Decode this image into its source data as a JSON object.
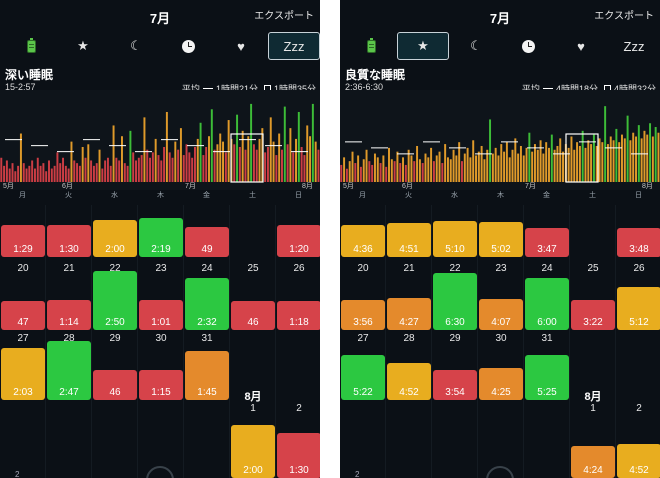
{
  "colors": {
    "background": "#0b1016",
    "red": "#d6434a",
    "yellow": "#e8ad1f",
    "green": "#2cc841",
    "orange": "#e48a2c",
    "chart_red": "#cc3d44",
    "chart_orange": "#df9a2a",
    "chart_green": "#3dbd38"
  },
  "panels": [
    {
      "header": {
        "title": "7月",
        "export_label": "エクスポート"
      },
      "tabs": [
        {
          "icon": "battery-icon",
          "text": "",
          "active": false
        },
        {
          "icon": "star-icon",
          "text": "★",
          "active": false
        },
        {
          "icon": "moon-icon",
          "text": "☾",
          "active": false
        },
        {
          "icon": "clock-icon",
          "text": "",
          "active": false
        },
        {
          "icon": "heart-icon",
          "text": "♥",
          "active": false
        },
        {
          "icon": "zzz-icon",
          "text": "Zzz",
          "active": true
        }
      ],
      "metric": {
        "title": "深い睡眠",
        "range": "15-2:57",
        "average_label": "平均",
        "average_value": "1時間21分",
        "box_value": "1時間35分"
      },
      "axis_months": [
        "5月",
        "6月",
        "7月",
        "8月"
      ],
      "weekdays": [
        "月",
        "火",
        "水",
        "木",
        "金",
        "土",
        "日"
      ],
      "month_label_next": "8月",
      "weeks": [
        {
          "days": [
            {
              "day": "",
              "value": "1:29",
              "color": "red",
              "level": 0.3
            },
            {
              "day": "",
              "value": "1:30",
              "color": "red",
              "level": 0.3
            },
            {
              "day": "",
              "value": "2:00",
              "color": "yellow",
              "level": 0.4
            },
            {
              "day": "",
              "value": "2:19",
              "color": "green",
              "level": 0.44
            },
            {
              "day": "",
              "value": "49",
              "color": "red",
              "level": 0.26
            },
            {
              "day": "",
              "value": "",
              "color": "",
              "level": 0
            },
            {
              "day": "",
              "value": "1:20",
              "color": "red",
              "level": 0.3
            }
          ]
        },
        {
          "days": [
            {
              "day": "20",
              "value": "47",
              "color": "red",
              "level": 0.22
            },
            {
              "day": "21",
              "value": "1:14",
              "color": "red",
              "level": 0.26
            },
            {
              "day": "22",
              "value": "2:50",
              "color": "green",
              "level": 0.86
            },
            {
              "day": "23",
              "value": "1:01",
              "color": "red",
              "level": 0.24
            },
            {
              "day": "24",
              "value": "2:32",
              "color": "green",
              "level": 0.7
            },
            {
              "day": "25",
              "value": "46",
              "color": "red",
              "level": 0.22
            },
            {
              "day": "26",
              "value": "1:18",
              "color": "red",
              "level": 0.22
            }
          ]
        },
        {
          "days": [
            {
              "day": "27",
              "value": "2:03",
              "color": "yellow",
              "level": 0.7
            },
            {
              "day": "28",
              "value": "2:47",
              "color": "green",
              "level": 0.86
            },
            {
              "day": "29",
              "value": "46",
              "color": "red",
              "level": 0.24
            },
            {
              "day": "30",
              "value": "1:15",
              "color": "red",
              "level": 0.26
            },
            {
              "day": "31",
              "value": "1:45",
              "color": "orange",
              "level": 0.64
            },
            {
              "day": "",
              "value": "",
              "color": "",
              "level": 0
            },
            {
              "day": "",
              "value": "",
              "color": "",
              "level": 0
            }
          ]
        },
        {
          "days": [
            {
              "day": "",
              "value": "",
              "color": "",
              "level": 0
            },
            {
              "day": "",
              "value": "",
              "color": "",
              "level": 0
            },
            {
              "day": "",
              "value": "",
              "color": "",
              "level": 0
            },
            {
              "day": "",
              "value": "",
              "color": "",
              "level": 0
            },
            {
              "day": "",
              "value": "",
              "color": "",
              "level": 0
            },
            {
              "day": "1",
              "value": "2:00",
              "color": "yellow",
              "level": 0.72
            },
            {
              "day": "2",
              "value": "1:30",
              "color": "red",
              "level": 0.56
            }
          ]
        }
      ],
      "bottom_partial": "2"
    },
    {
      "header": {
        "title": "7月",
        "export_label": "エクスポート"
      },
      "tabs": [
        {
          "icon": "battery-icon",
          "text": "",
          "active": false
        },
        {
          "icon": "star-icon",
          "text": "★",
          "active": true
        },
        {
          "icon": "moon-icon",
          "text": "☾",
          "active": false
        },
        {
          "icon": "clock-icon",
          "text": "",
          "active": false
        },
        {
          "icon": "heart-icon",
          "text": "♥",
          "active": false
        },
        {
          "icon": "zzz-icon",
          "text": "Zzz",
          "active": false
        }
      ],
      "metric": {
        "title": "良質な睡眠",
        "range": "2:36-6:30",
        "average_label": "平均",
        "average_value": "4時間18分",
        "box_value": "4時間32分"
      },
      "axis_months": [
        "5月",
        "6月",
        "7月",
        "8月"
      ],
      "weekdays": [
        "月",
        "火",
        "水",
        "木",
        "金",
        "土",
        "日"
      ],
      "month_label_next": "8月",
      "weeks": [
        {
          "days": [
            {
              "day": "",
              "value": "4:36",
              "color": "yellow",
              "level": 0.3
            },
            {
              "day": "",
              "value": "4:51",
              "color": "yellow",
              "level": 0.34
            },
            {
              "day": "",
              "value": "5:10",
              "color": "yellow",
              "level": 0.38
            },
            {
              "day": "",
              "value": "5:02",
              "color": "yellow",
              "level": 0.36
            },
            {
              "day": "",
              "value": "3:47",
              "color": "red",
              "level": 0.22
            },
            {
              "day": "",
              "value": "",
              "color": "",
              "level": 0
            },
            {
              "day": "",
              "value": "3:48",
              "color": "red",
              "level": 0.22
            }
          ]
        },
        {
          "days": [
            {
              "day": "20",
              "value": "3:56",
              "color": "orange",
              "level": 0.26
            },
            {
              "day": "21",
              "value": "4:27",
              "color": "orange",
              "level": 0.3
            },
            {
              "day": "22",
              "value": "6:30",
              "color": "green",
              "level": 0.82
            },
            {
              "day": "23",
              "value": "4:07",
              "color": "orange",
              "level": 0.28
            },
            {
              "day": "24",
              "value": "6:00",
              "color": "green",
              "level": 0.7
            },
            {
              "day": "25",
              "value": "3:22",
              "color": "red",
              "level": 0.26
            },
            {
              "day": "26",
              "value": "5:12",
              "color": "yellow",
              "level": 0.52
            }
          ]
        },
        {
          "days": [
            {
              "day": "27",
              "value": "5:22",
              "color": "green",
              "level": 0.56
            },
            {
              "day": "28",
              "value": "4:52",
              "color": "yellow",
              "level": 0.4
            },
            {
              "day": "29",
              "value": "3:54",
              "color": "red",
              "level": 0.26
            },
            {
              "day": "30",
              "value": "4:25",
              "color": "orange",
              "level": 0.3
            },
            {
              "day": "31",
              "value": "5:25",
              "color": "green",
              "level": 0.56
            },
            {
              "day": "",
              "value": "",
              "color": "",
              "level": 0
            },
            {
              "day": "",
              "value": "",
              "color": "",
              "level": 0
            }
          ]
        },
        {
          "days": [
            {
              "day": "",
              "value": "",
              "color": "",
              "level": 0
            },
            {
              "day": "",
              "value": "",
              "color": "",
              "level": 0
            },
            {
              "day": "",
              "value": "",
              "color": "",
              "level": 0
            },
            {
              "day": "",
              "value": "",
              "color": "",
              "level": 0
            },
            {
              "day": "",
              "value": "",
              "color": "",
              "level": 0
            },
            {
              "day": "1",
              "value": "4:24",
              "color": "orange",
              "level": 0.3
            },
            {
              "day": "2",
              "value": "4:52",
              "color": "yellow",
              "level": 0.34
            }
          ]
        }
      ],
      "bottom_partial": "2"
    }
  ],
  "chart_data": [
    {
      "type": "bar",
      "series": [
        {
          "values": [
            0.9,
            0.6,
            0.8,
            0.5,
            0.7,
            0.4,
            0.6,
            1.8,
            0.7,
            0.5,
            0.6,
            0.8,
            0.5,
            0.9,
            0.6,
            0.7,
            0.4,
            0.8,
            0.5,
            0.6,
            1.1,
            0.7,
            0.9,
            0.6,
            0.5,
            1.5,
            0.8,
            0.7,
            0.6,
            1.3,
            0.9,
            1.4,
            0.8,
            0.6,
            0.7,
            1.2,
            0.5,
            0.8,
            0.9,
            0.6,
            2.1,
            0.9,
            0.8,
            1.7,
            0.7,
            0.6,
            1.9,
            1.1,
            0.8,
            0.9,
            1.0,
            2.4,
            1.2,
            0.9,
            1.1,
            1.6,
            1.0,
            0.8,
            1.3,
            2.6,
            1.1,
            0.9,
            1.5,
            1.2,
            2.0,
            1.0,
            1.4,
            1.1,
            0.9,
            1.3,
            1.6,
            2.2,
            1.0,
            1.3,
            1.7,
            2.7,
            1.2,
            1.4,
            1.8,
            1.5,
            1.1,
            2.3,
            1.6,
            1.4,
            2.5,
            1.3,
            1.9,
            1.2,
            1.7,
            2.9,
            1.4,
            1.2,
            1.6,
            2.0,
            1.1,
            1.3,
            2.4,
            1.5,
            1.0,
            1.8,
            1.2,
            2.8,
            1.4,
            2.0,
            1.1,
            1.6,
            2.6,
            1.3,
            1.0,
            2.1,
            1.7,
            2.9,
            1.5,
            1.2
          ],
          "colors": [
            "r",
            "r",
            "r",
            "r",
            "r",
            "r",
            "r",
            "o",
            "r",
            "r",
            "r",
            "r",
            "r",
            "r",
            "r",
            "r",
            "r",
            "r",
            "r",
            "r",
            "r",
            "r",
            "r",
            "r",
            "r",
            "o",
            "r",
            "r",
            "r",
            "o",
            "r",
            "o",
            "r",
            "r",
            "r",
            "o",
            "r",
            "r",
            "r",
            "r",
            "o",
            "r",
            "r",
            "o",
            "r",
            "r",
            "g",
            "r",
            "r",
            "r",
            "r",
            "o",
            "r",
            "r",
            "r",
            "o",
            "r",
            "r",
            "r",
            "o",
            "r",
            "r",
            "o",
            "r",
            "o",
            "r",
            "r",
            "r",
            "r",
            "r",
            "o",
            "g",
            "r",
            "r",
            "o",
            "g",
            "r",
            "o",
            "o",
            "o",
            "r",
            "o",
            "o",
            "r",
            "g",
            "r",
            "o",
            "r",
            "o",
            "g",
            "r",
            "r",
            "o",
            "o",
            "r",
            "r",
            "o",
            "o",
            "r",
            "o",
            "r",
            "g",
            "r",
            "o",
            "r",
            "o",
            "g",
            "r",
            "r",
            "o",
            "o",
            "g",
            "o",
            "r"
          ]
        }
      ],
      "average_line_y": 1.35
    },
    {
      "type": "bar",
      "series": [
        {
          "values": [
            3.4,
            3.8,
            3.2,
            3.6,
            4.1,
            3.5,
            3.9,
            3.3,
            3.7,
            4.2,
            3.6,
            3.4,
            4.0,
            3.8,
            3.5,
            3.9,
            3.3,
            4.3,
            3.7,
            3.6,
            4.1,
            3.5,
            3.8,
            3.4,
            4.2,
            3.9,
            3.6,
            4.4,
            3.7,
            3.5,
            4.0,
            3.8,
            4.3,
            3.6,
            3.9,
            4.1,
            3.5,
            4.5,
            3.8,
            3.7,
            4.2,
            3.9,
            4.6,
            3.6,
            4.0,
            4.3,
            3.8,
            4.7,
            3.9,
            4.1,
            4.4,
            3.7,
            4.2,
            5.8,
            4.0,
            4.3,
            3.9,
            4.5,
            4.1,
            4.6,
            3.8,
            4.2,
            4.8,
            4.0,
            4.4,
            3.9,
            4.3,
            5.1,
            4.1,
            4.5,
            4.2,
            4.7,
            4.0,
            4.6,
            4.3,
            5.0,
            4.2,
            4.4,
            4.8,
            4.1,
            4.5,
            4.3,
            4.9,
            4.2,
            4.6,
            4.4,
            5.2,
            4.3,
            4.7,
            4.5,
            5.0,
            4.4,
            4.8,
            4.6,
            6.5,
            4.5,
            4.9,
            4.7,
            5.3,
            4.6,
            5.0,
            4.8,
            6.0,
            4.7,
            5.1,
            4.9,
            5.5,
            4.8,
            5.2,
            5.0,
            5.6,
            4.9,
            5.4,
            5.1
          ],
          "colors": [
            "r",
            "o",
            "r",
            "o",
            "o",
            "r",
            "o",
            "r",
            "o",
            "o",
            "r",
            "r",
            "o",
            "o",
            "r",
            "o",
            "r",
            "o",
            "o",
            "r",
            "o",
            "r",
            "o",
            "r",
            "o",
            "o",
            "r",
            "o",
            "o",
            "r",
            "o",
            "o",
            "o",
            "r",
            "o",
            "o",
            "r",
            "o",
            "o",
            "o",
            "o",
            "o",
            "o",
            "r",
            "o",
            "o",
            "o",
            "o",
            "o",
            "o",
            "o",
            "o",
            "o",
            "g",
            "o",
            "o",
            "o",
            "o",
            "o",
            "o",
            "o",
            "o",
            "o",
            "o",
            "o",
            "o",
            "o",
            "g",
            "o",
            "o",
            "o",
            "o",
            "o",
            "o",
            "o",
            "g",
            "o",
            "o",
            "o",
            "o",
            "o",
            "o",
            "o",
            "o",
            "o",
            "o",
            "g",
            "o",
            "o",
            "o",
            "g",
            "o",
            "o",
            "o",
            "g",
            "o",
            "o",
            "o",
            "g",
            "o",
            "o",
            "o",
            "g",
            "o",
            "o",
            "o",
            "g",
            "o",
            "o",
            "o",
            "g",
            "o",
            "g",
            "o"
          ]
        }
      ],
      "average_line_y": 4.3
    }
  ]
}
